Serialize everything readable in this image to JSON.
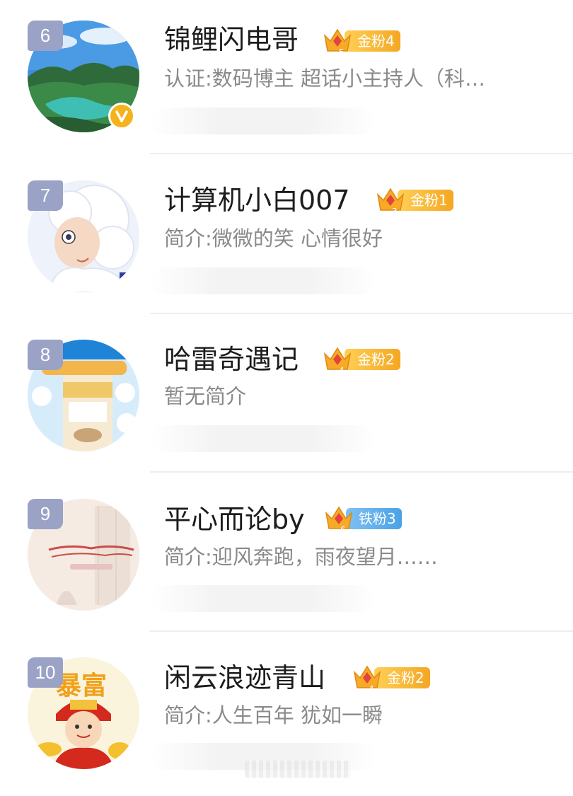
{
  "users": [
    {
      "rank": "6",
      "name": "锦鲤闪电哥",
      "crown_level": "5",
      "fan_badge": "金粉4",
      "badge_type": "gold",
      "description": "认证:数码博主 超话小主持人（科…",
      "verified": true,
      "avatar": "mountain-lake-photo"
    },
    {
      "rank": "7",
      "name": "计算机小白007",
      "crown_level": "3",
      "fan_badge": "金粉1",
      "badge_type": "gold",
      "description": "简介:微微的笑 心情很好",
      "verified": false,
      "avatar": "anime-character"
    },
    {
      "rank": "8",
      "name": "哈雷奇遇记",
      "crown_level": "4",
      "fan_badge": "金粉2",
      "badge_type": "gold",
      "description": "暂无简介",
      "verified": false,
      "avatar": "milk-powder-product"
    },
    {
      "rank": "9",
      "name": "平心而论by",
      "crown_level": "6",
      "fan_badge": "铁粉3",
      "badge_type": "iron",
      "description": "简介:迎风奔跑，雨夜望月……",
      "verified": false,
      "avatar": "calligraphy-card"
    },
    {
      "rank": "10",
      "name": "闲云浪迹青山",
      "crown_level": "4",
      "fan_badge": "金粉2",
      "badge_type": "gold",
      "description": "简介:人生百年 犹如一瞬",
      "verified": false,
      "avatar": "fortune-god-cartoon",
      "avatar_text": "暴富"
    }
  ],
  "colors": {
    "rank_badge": "#9aa2c6",
    "gold_badge": "#f4a723",
    "iron_badge": "#4aa2e6",
    "verified": "#f6b21b",
    "name_text": "#1c1c1c",
    "desc_text": "#8a8a8a"
  }
}
